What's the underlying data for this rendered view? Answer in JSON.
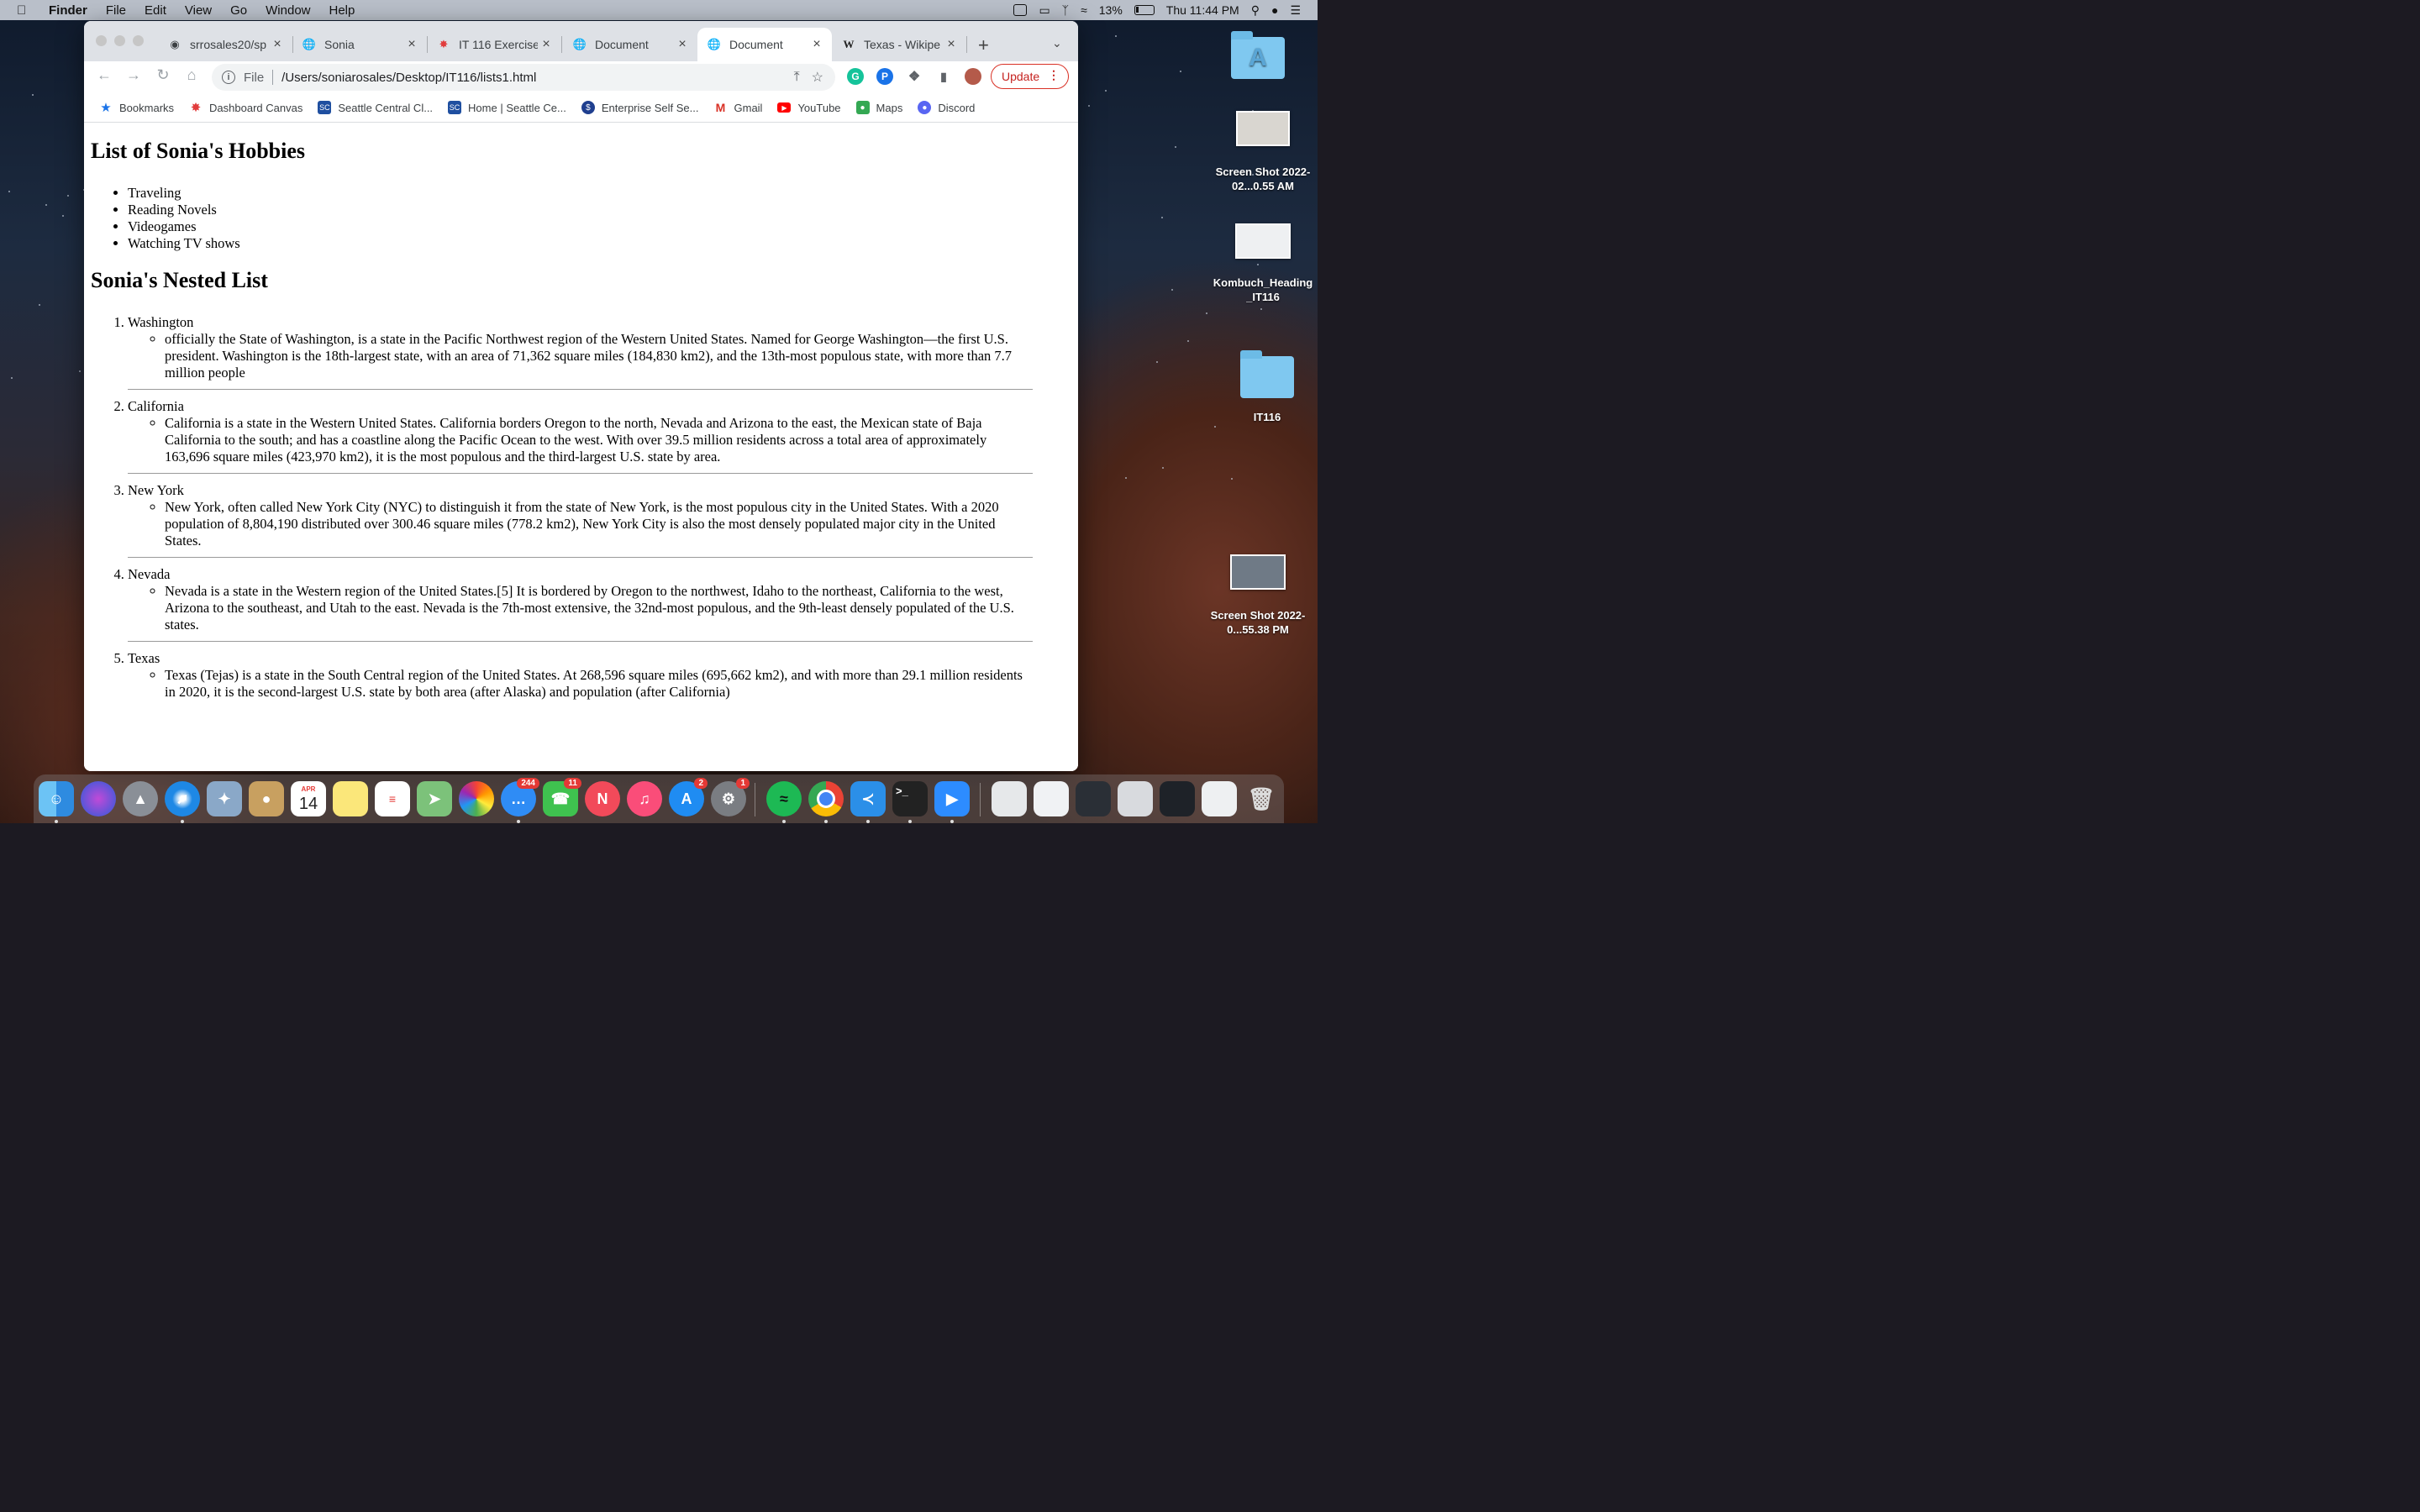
{
  "menubar": {
    "app": "Finder",
    "items": [
      "File",
      "Edit",
      "View",
      "Go",
      "Window",
      "Help"
    ],
    "battery": "13%",
    "clock": "Thu 11:44 PM"
  },
  "browser": {
    "tabs": [
      {
        "title": "srrosales20/sp",
        "icon": "github-icon"
      },
      {
        "title": "Sonia",
        "icon": "globe-icon"
      },
      {
        "title": "IT 116 Exercise",
        "icon": "canvas-icon"
      },
      {
        "title": "Document",
        "icon": "globe-icon"
      },
      {
        "title": "Document",
        "icon": "globe-icon",
        "active": true
      },
      {
        "title": "Texas - Wikipe",
        "icon": "wikipedia-icon"
      }
    ],
    "address": {
      "scheme": "File",
      "url": "/Users/soniarosales/Desktop/IT116/lists1.html"
    },
    "update_label": "Update",
    "bookmarks": [
      {
        "label": "Bookmarks",
        "icon": "star-icon"
      },
      {
        "label": "Dashboard Canvas",
        "icon": "canvas-icon"
      },
      {
        "label": "Seattle Central Cl...",
        "icon": "seattle-central-icon"
      },
      {
        "label": "Home | Seattle Ce...",
        "icon": "seattle-central-icon"
      },
      {
        "label": "Enterprise Self Se...",
        "icon": "enterprise-icon"
      },
      {
        "label": "Gmail",
        "icon": "gmail-icon"
      },
      {
        "label": "YouTube",
        "icon": "youtube-icon"
      },
      {
        "label": "Maps",
        "icon": "maps-icon"
      },
      {
        "label": "Discord",
        "icon": "discord-icon"
      }
    ]
  },
  "page": {
    "hobbies_heading": "List of Sonia's Hobbies",
    "hobbies": [
      "Traveling",
      "Reading Novels",
      "Videogames",
      "Watching TV shows"
    ],
    "nested_heading": "Sonia's Nested List",
    "nested": [
      {
        "name": "Washington",
        "desc": "officially the State of Washington, is a state in the Pacific Northwest region of the Western United States. Named for George Washington—the first U.S. president. Washington is the 18th-largest state, with an area of 71,362 square miles (184,830 km2), and the 13th-most populous state, with more than 7.7 million people"
      },
      {
        "name": "California",
        "desc": "California is a state in the Western United States. California borders Oregon to the north, Nevada and Arizona to the east, the Mexican state of Baja California to the south; and has a coastline along the Pacific Ocean to the west. With over 39.5 million residents across a total area of approximately 163,696 square miles (423,970 km2), it is the most populous and the third-largest U.S. state by area."
      },
      {
        "name": "New York",
        "desc": "New York, often called New York City (NYC) to distinguish it from the state of New York, is the most populous city in the United States. With a 2020 population of 8,804,190 distributed over 300.46 square miles (778.2 km2), New York City is also the most densely populated major city in the United States."
      },
      {
        "name": "Nevada",
        "desc": "Nevada is a state in the Western region of the United States.[5] It is bordered by Oregon to the northwest, Idaho to the northeast, California to the west, Arizona to the southeast, and Utah to the east. Nevada is the 7th-most extensive, the 32nd-most populous, and the 9th-least densely populated of the U.S. states."
      },
      {
        "name": "Texas",
        "desc": "Texas (Tejas) is a state in the South Central region of the United States. At 268,596 square miles (695,662 km2), and with more than 29.1 million residents in 2020, it is the second-largest U.S. state by both area (after Alaska) and population (after California)"
      }
    ]
  },
  "desktop": {
    "icons": [
      {
        "label": "",
        "kind": "folder-icon"
      },
      {
        "label": "Screen Shot 2022-02...0.55 AM",
        "kind": "screenshot"
      },
      {
        "label": "Kombuch_Heading _IT116",
        "kind": "screenshot"
      },
      {
        "label": "IT116",
        "kind": "folder-icon"
      },
      {
        "label": "Screen Shot 2022-0...55.38 PM",
        "kind": "screenshot"
      }
    ]
  },
  "dock": {
    "calendar_month": "APR",
    "calendar_day": "14",
    "badges": {
      "messages": "244",
      "facetime": "11",
      "appstore": "2",
      "settings": "1"
    }
  }
}
